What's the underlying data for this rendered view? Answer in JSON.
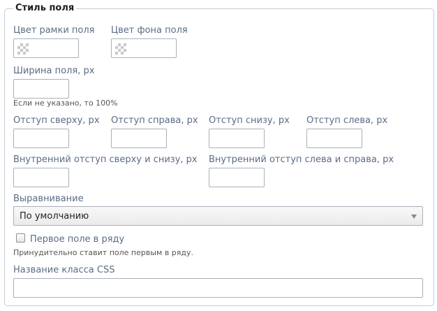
{
  "section": {
    "title": "Стиль поля"
  },
  "fields": {
    "border_color": {
      "label": "Цвет рамки поля",
      "value": ""
    },
    "background_color": {
      "label": "Цвет фона поля",
      "value": ""
    },
    "width": {
      "label": "Ширина поля, px",
      "value": "",
      "hint": "Если не указано, то 100%"
    },
    "margin_top": {
      "label": "Отступ сверху, px",
      "value": ""
    },
    "margin_right": {
      "label": "Отступ справа, px",
      "value": ""
    },
    "margin_bottom": {
      "label": "Отступ снизу, px",
      "value": ""
    },
    "margin_left": {
      "label": "Отступ слева, px",
      "value": ""
    },
    "padding_vertical": {
      "label": "Внутренний отступ сверху и снизу, px",
      "value": ""
    },
    "padding_horizontal": {
      "label": "Внутренний отступ слева и справа, px",
      "value": ""
    },
    "alignment": {
      "label": "Выравнивание",
      "selected": "По умолчанию"
    },
    "first_in_row": {
      "label": "Первое поле в ряду",
      "checked": false,
      "hint": "Принудительно ставит поле первым в ряду."
    },
    "css_class": {
      "label": "Название класса CSS",
      "value": ""
    }
  },
  "icons": {
    "color_swatch": "transparent-checker-icon",
    "dropdown": "chevron-down-icon"
  }
}
